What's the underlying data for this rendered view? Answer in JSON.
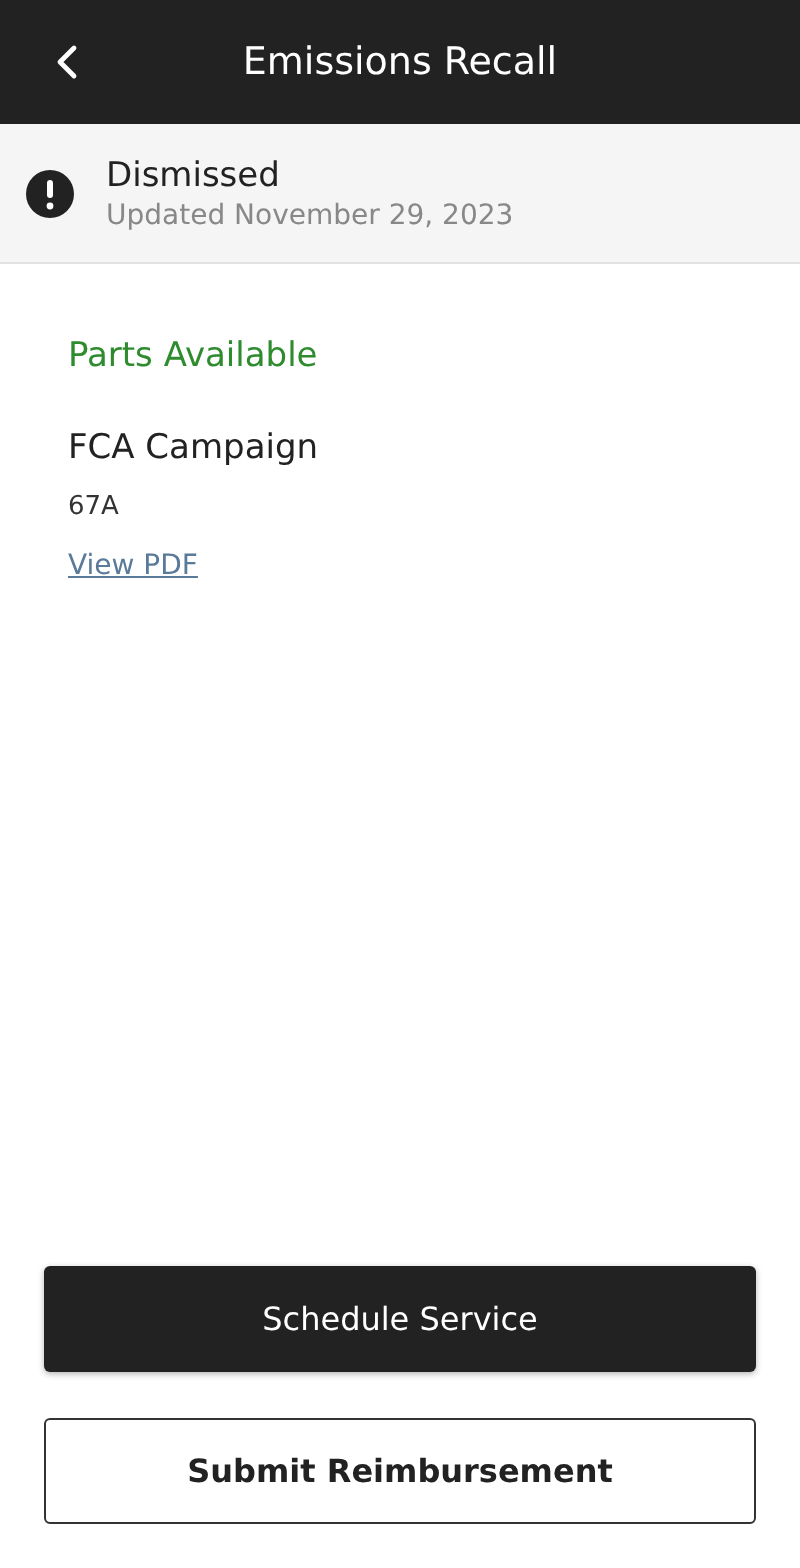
{
  "header": {
    "title": "Emissions Recall"
  },
  "status": {
    "title": "Dismissed",
    "updated": "Updated November 29, 2023"
  },
  "details": {
    "availability": "Parts Available",
    "campaign_title": "FCA Campaign",
    "campaign_code": "67A",
    "link": "View PDF"
  },
  "buttons": [
    {
      "label": "Schedule Service",
      "kind": "primary"
    },
    {
      "label": "Submit Reimbursement",
      "kind": "secondary"
    }
  ]
}
